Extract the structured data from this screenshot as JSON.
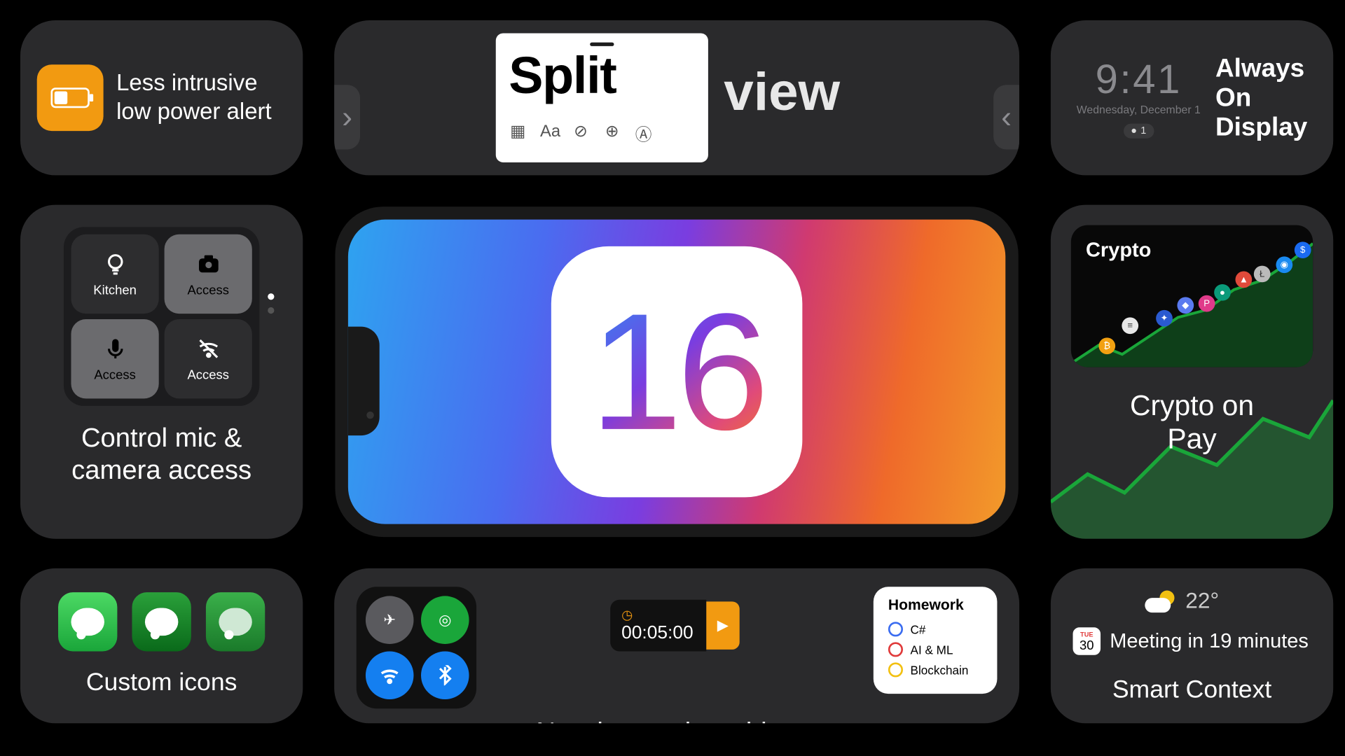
{
  "low_power": {
    "text": "Less intrusive\nlow power alert"
  },
  "split": {
    "title": "Split",
    "word": "view"
  },
  "aod": {
    "time": "9:41",
    "date": "Wednesday, December 1",
    "badge": "1",
    "label": "Always\nOn\nDisplay"
  },
  "access": {
    "tiles": [
      {
        "label": "Kitchen",
        "icon": "bulb",
        "selected": false
      },
      {
        "label": "Access",
        "icon": "camera",
        "selected": true
      },
      {
        "label": "Access",
        "icon": "mic",
        "selected": true
      },
      {
        "label": "Access",
        "icon": "wifi-off",
        "selected": false
      }
    ],
    "text": "Control mic &\ncamera access"
  },
  "ios": {
    "number": "16"
  },
  "crypto": {
    "header": "Crypto",
    "text": "Crypto on\n Pay"
  },
  "custom_icons": {
    "text": "Custom icons"
  },
  "widgets": {
    "timer": "00:05:00",
    "homework": {
      "title": "Homework",
      "items": [
        {
          "label": "C#",
          "color": "#3a6cf0"
        },
        {
          "label": "AI & ML",
          "color": "#e03a3a"
        },
        {
          "label": "Blockchain",
          "color": "#f2c011"
        }
      ]
    },
    "text": "New interactive widgets"
  },
  "context": {
    "temp": "22°",
    "cal_month": "TUE",
    "cal_day": "30",
    "meeting": "Meeting in 19 minutes",
    "text": "Smart Context"
  }
}
